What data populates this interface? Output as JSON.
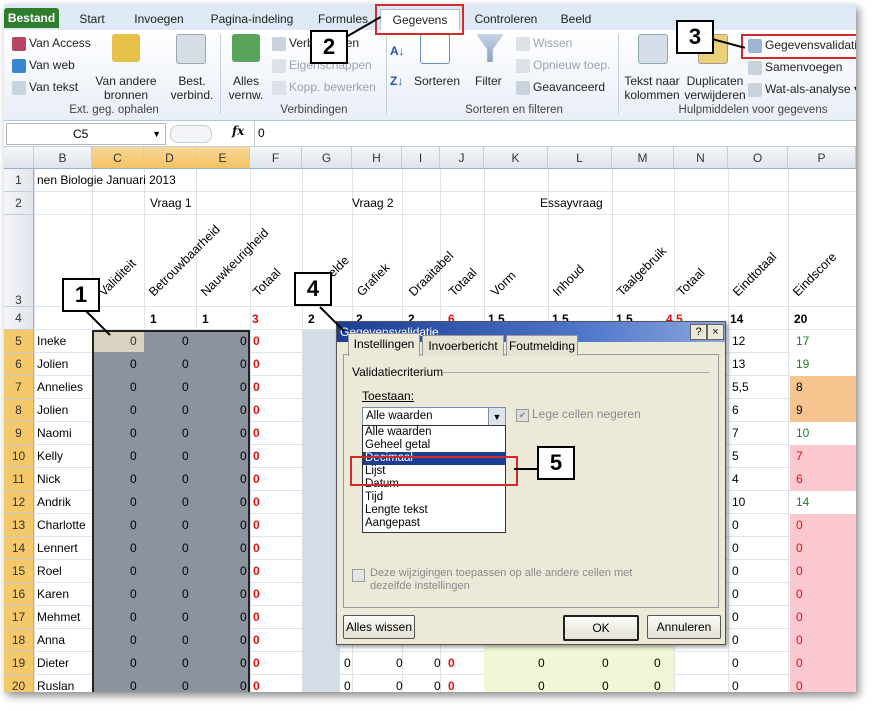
{
  "ribbon_tabs": [
    "Bestand",
    "Start",
    "Invoegen",
    "Pagina-indeling",
    "Formules",
    "Gegevens",
    "Controleren",
    "Beeld"
  ],
  "ribbon": {
    "ext": {
      "access": "Van Access",
      "web": "Van web",
      "text": "Van tekst",
      "other1": "Van andere",
      "other2": "bronnen",
      "existing1": "Best.",
      "existing2": "verbind.",
      "label": "Ext. geg. ophalen"
    },
    "conn": {
      "refresh1": "Alles",
      "refresh2": "vernw.",
      "connections": "Verbindingen",
      "properties": "Eigenschappen",
      "edit_links": "Kopp. bewerken",
      "label": "Verbindingen"
    },
    "sort": {
      "sort": "Sorteren",
      "filter": "Filter",
      "clear": "Wissen",
      "reapply": "Opnieuw toep.",
      "advanced": "Geavanceerd",
      "label": "Sorteren en filteren"
    },
    "tools": {
      "text_cols1": "Tekst naar",
      "text_cols2": "kolommen",
      "dup1": "Duplicaten",
      "dup2": "verwijderen",
      "validation": "Gegevensvalidatie",
      "consolidate": "Samenvoegen",
      "whatif": "Wat-als-analyse",
      "label": "Hulpmiddelen voor gegevens"
    }
  },
  "formula_bar": {
    "namebox": "C5",
    "fx": "fx",
    "value": "0"
  },
  "columns": [
    "B",
    "C",
    "D",
    "E",
    "F",
    "G",
    "H",
    "I",
    "J",
    "K",
    "L",
    "M",
    "N",
    "O",
    "P"
  ],
  "rows": [
    "1",
    "2",
    "3",
    "4",
    "5",
    "6",
    "7",
    "8",
    "9",
    "10",
    "11",
    "12",
    "13",
    "14",
    "15",
    "16",
    "17",
    "18",
    "19",
    "20"
  ],
  "sheet": {
    "title": "nen Biologie Januari 2013",
    "q1": "Vraag 1",
    "q2": "Vraag 2",
    "essay": "Essayvraag",
    "headers3": [
      "Validiteit",
      "Betrouwbaarheid",
      "Nauwkeurigheid",
      "Totaal",
      "Middelde",
      "Grafiek",
      "Draaitabel",
      "Totaal",
      "Vorm",
      "Inhoud",
      "Taalgebruik",
      "Totaal",
      "Eindtotaal",
      "Eindscore"
    ],
    "max4": [
      "1",
      "1",
      "3",
      "2",
      "2",
      "2",
      "6",
      "1.5",
      "1.5",
      "1.5",
      "4.5",
      "14",
      "20"
    ],
    "names": [
      "Ineke",
      "Jolien",
      "Annelies",
      "Jolien",
      "Naomi",
      "Kelly",
      "Nick",
      "Andrik",
      "Charlotte",
      "Lennert",
      "Roel",
      "Karen",
      "Mehmet",
      "Anna",
      "Dieter",
      "Ruslan"
    ],
    "zero": "0",
    "eindtotaal": [
      "12",
      "13",
      "5,5",
      "6",
      "7",
      "5",
      "4",
      "10",
      "0",
      "0",
      "0",
      "0",
      "0",
      "0",
      "0",
      "0"
    ],
    "eindscore": [
      "17",
      "19",
      "8",
      "9",
      "10",
      "7",
      "6",
      "14",
      "0",
      "0",
      "0",
      "0",
      "0",
      "0",
      "0",
      "0"
    ]
  },
  "dialog": {
    "title": "Gegevensvalidatie",
    "help": "?",
    "close": "×",
    "tabs": [
      "Instellingen",
      "Invoerbericht",
      "Foutmelding"
    ],
    "section": "Validatiecriterium",
    "allow_label": "Toestaan:",
    "allow_value": "Alle waarden",
    "ignore_blank": "Lege cellen negeren",
    "options": [
      "Alle waarden",
      "Geheel getal",
      "Decimaal",
      "Lijst",
      "Datum",
      "Tijd",
      "Lengte tekst",
      "Aangepast"
    ],
    "selected_option": "Decimaal",
    "apply_all": "Deze wijzigingen toepassen op alle andere cellen met dezelfde instellingen",
    "clear_all": "Alles wissen",
    "ok": "OK",
    "cancel": "Annuleren"
  },
  "callouts": [
    "1",
    "2",
    "3",
    "4",
    "5"
  ],
  "colors": {
    "accent_red": "#d12a2a",
    "selected_gray": "#8c939e",
    "orange": "#f6c48e",
    "pink": "#fbc8d0",
    "green_text": "#1e7d32",
    "red_text": "#e01010"
  }
}
